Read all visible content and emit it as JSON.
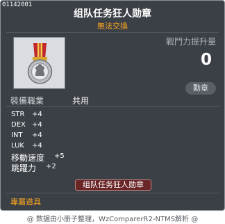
{
  "tooltip": {
    "item_id": "01142001",
    "title": "组队任务狂人勋章",
    "untradable": "無法交換",
    "power_label": "戰鬥力提升量",
    "power_value": "0",
    "medal_badge": "勳章",
    "job_label": "裝備職業",
    "job_value": "共用",
    "stats": [
      {
        "name": "STR",
        "value": "+4"
      },
      {
        "name": "DEX",
        "value": "+4"
      },
      {
        "name": "INT",
        "value": "+4"
      },
      {
        "name": "LUK",
        "value": "+4"
      },
      {
        "name": "移動速度",
        "value": "+5"
      },
      {
        "name": "跳躍力",
        "value": "+2"
      }
    ],
    "medal_tag": "组队任务狂人勋章",
    "quest_item": "專屬道具"
  },
  "footer": "@ 数据由小册子整理，WzComparerR2-NTMS解析 @",
  "colors": {
    "background": "#3b3f46",
    "accent_orange": "#ffaa1e",
    "medal_tag_bg": "#6a2526"
  },
  "icons": {
    "item_icon": "medal-icon"
  }
}
